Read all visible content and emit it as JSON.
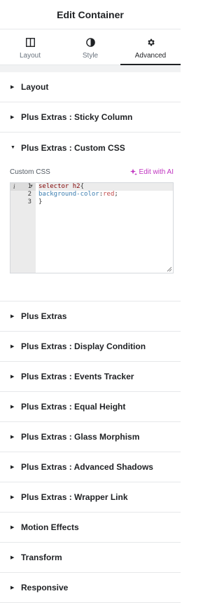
{
  "header": {
    "title": "Edit Container"
  },
  "tabs": [
    {
      "label": "Layout",
      "icon": "layout-icon",
      "active": false
    },
    {
      "label": "Style",
      "icon": "style-icon",
      "active": false
    },
    {
      "label": "Advanced",
      "icon": "gear-icon",
      "active": true
    }
  ],
  "sections_top": [
    {
      "title": "Layout"
    },
    {
      "title": "Plus Extras : Sticky Column"
    }
  ],
  "custom_css": {
    "title": "Plus Extras : Custom CSS",
    "label": "Custom CSS",
    "ai_label": "Edit with AI",
    "line_numbers": [
      "1",
      "2",
      "3"
    ],
    "code": {
      "line1_selector": "selector h2",
      "line1_brace": "{",
      "line2_prop": "background-color",
      "line2_colon": ":",
      "line2_value": "red",
      "line2_semi": ";",
      "line3": "}"
    }
  },
  "sections_bottom": [
    {
      "title": "Plus Extras"
    },
    {
      "title": "Plus Extras : Display Condition"
    },
    {
      "title": "Plus Extras : Events Tracker"
    },
    {
      "title": "Plus Extras : Equal Height"
    },
    {
      "title": "Plus Extras : Glass Morphism"
    },
    {
      "title": "Plus Extras : Advanced Shadows"
    },
    {
      "title": "Plus Extras : Wrapper Link"
    },
    {
      "title": "Motion Effects"
    },
    {
      "title": "Transform"
    },
    {
      "title": "Responsive"
    }
  ],
  "colors": {
    "accent_ai": "#c036c1",
    "text": "#1f2124",
    "muted": "#69727d"
  }
}
